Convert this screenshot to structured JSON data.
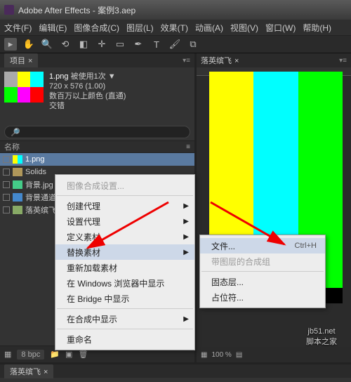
{
  "title": "Adobe After Effects - 案例3.aep",
  "menu": [
    "文件(F)",
    "编辑(E)",
    "图像合成(C)",
    "图层(L)",
    "效果(T)",
    "动画(A)",
    "视图(V)",
    "窗口(W)",
    "帮助(H)"
  ],
  "project_tab": "项目",
  "info": {
    "name": "1.png",
    "used": "被使用1次",
    "dim": "720 x 576 (1.00)",
    "colors": "数百万以上颜色 (直通)",
    "interlace": "交错"
  },
  "search_placeholder": "",
  "list_header": "名称",
  "items": [
    {
      "name": "1.png",
      "icon": "ic-img",
      "sel": true
    },
    {
      "name": "Solids",
      "icon": "ic-folder"
    },
    {
      "name": "背景.jpg",
      "icon": "ic-jpg"
    },
    {
      "name": "背景通道.tg...",
      "icon": "ic-tga"
    },
    {
      "name": "落英缤飞",
      "icon": "ic-comp"
    }
  ],
  "bpc": "8 bpc",
  "viewer_tab": "落英缤飞",
  "zoom": "100 %",
  "footer_tab": "落英缤飞",
  "ctx1": [
    {
      "t": "图像合成设置...",
      "dis": true
    },
    {
      "sep": true
    },
    {
      "t": "创建代理",
      "sub": true
    },
    {
      "t": "设置代理",
      "sub": true
    },
    {
      "t": "定义素材",
      "sub": true
    },
    {
      "t": "替换素材",
      "sub": true,
      "hl": true
    },
    {
      "t": "重新加载素材"
    },
    {
      "t": "在 Windows 浏览器中显示"
    },
    {
      "t": "在 Bridge 中显示"
    },
    {
      "sep": true
    },
    {
      "t": "在合成中显示",
      "sub": true
    },
    {
      "sep": true
    },
    {
      "t": "重命名"
    }
  ],
  "ctx2": [
    {
      "t": "文件...",
      "sc": "Ctrl+H",
      "hl": true
    },
    {
      "t": "带图层的合成组",
      "dis": true
    },
    {
      "sep": true
    },
    {
      "t": "固态层..."
    },
    {
      "t": "占位符..."
    }
  ],
  "watermark": {
    "l1": "jb51.net",
    "l2": "脚本之家"
  },
  "bullet": "▼"
}
